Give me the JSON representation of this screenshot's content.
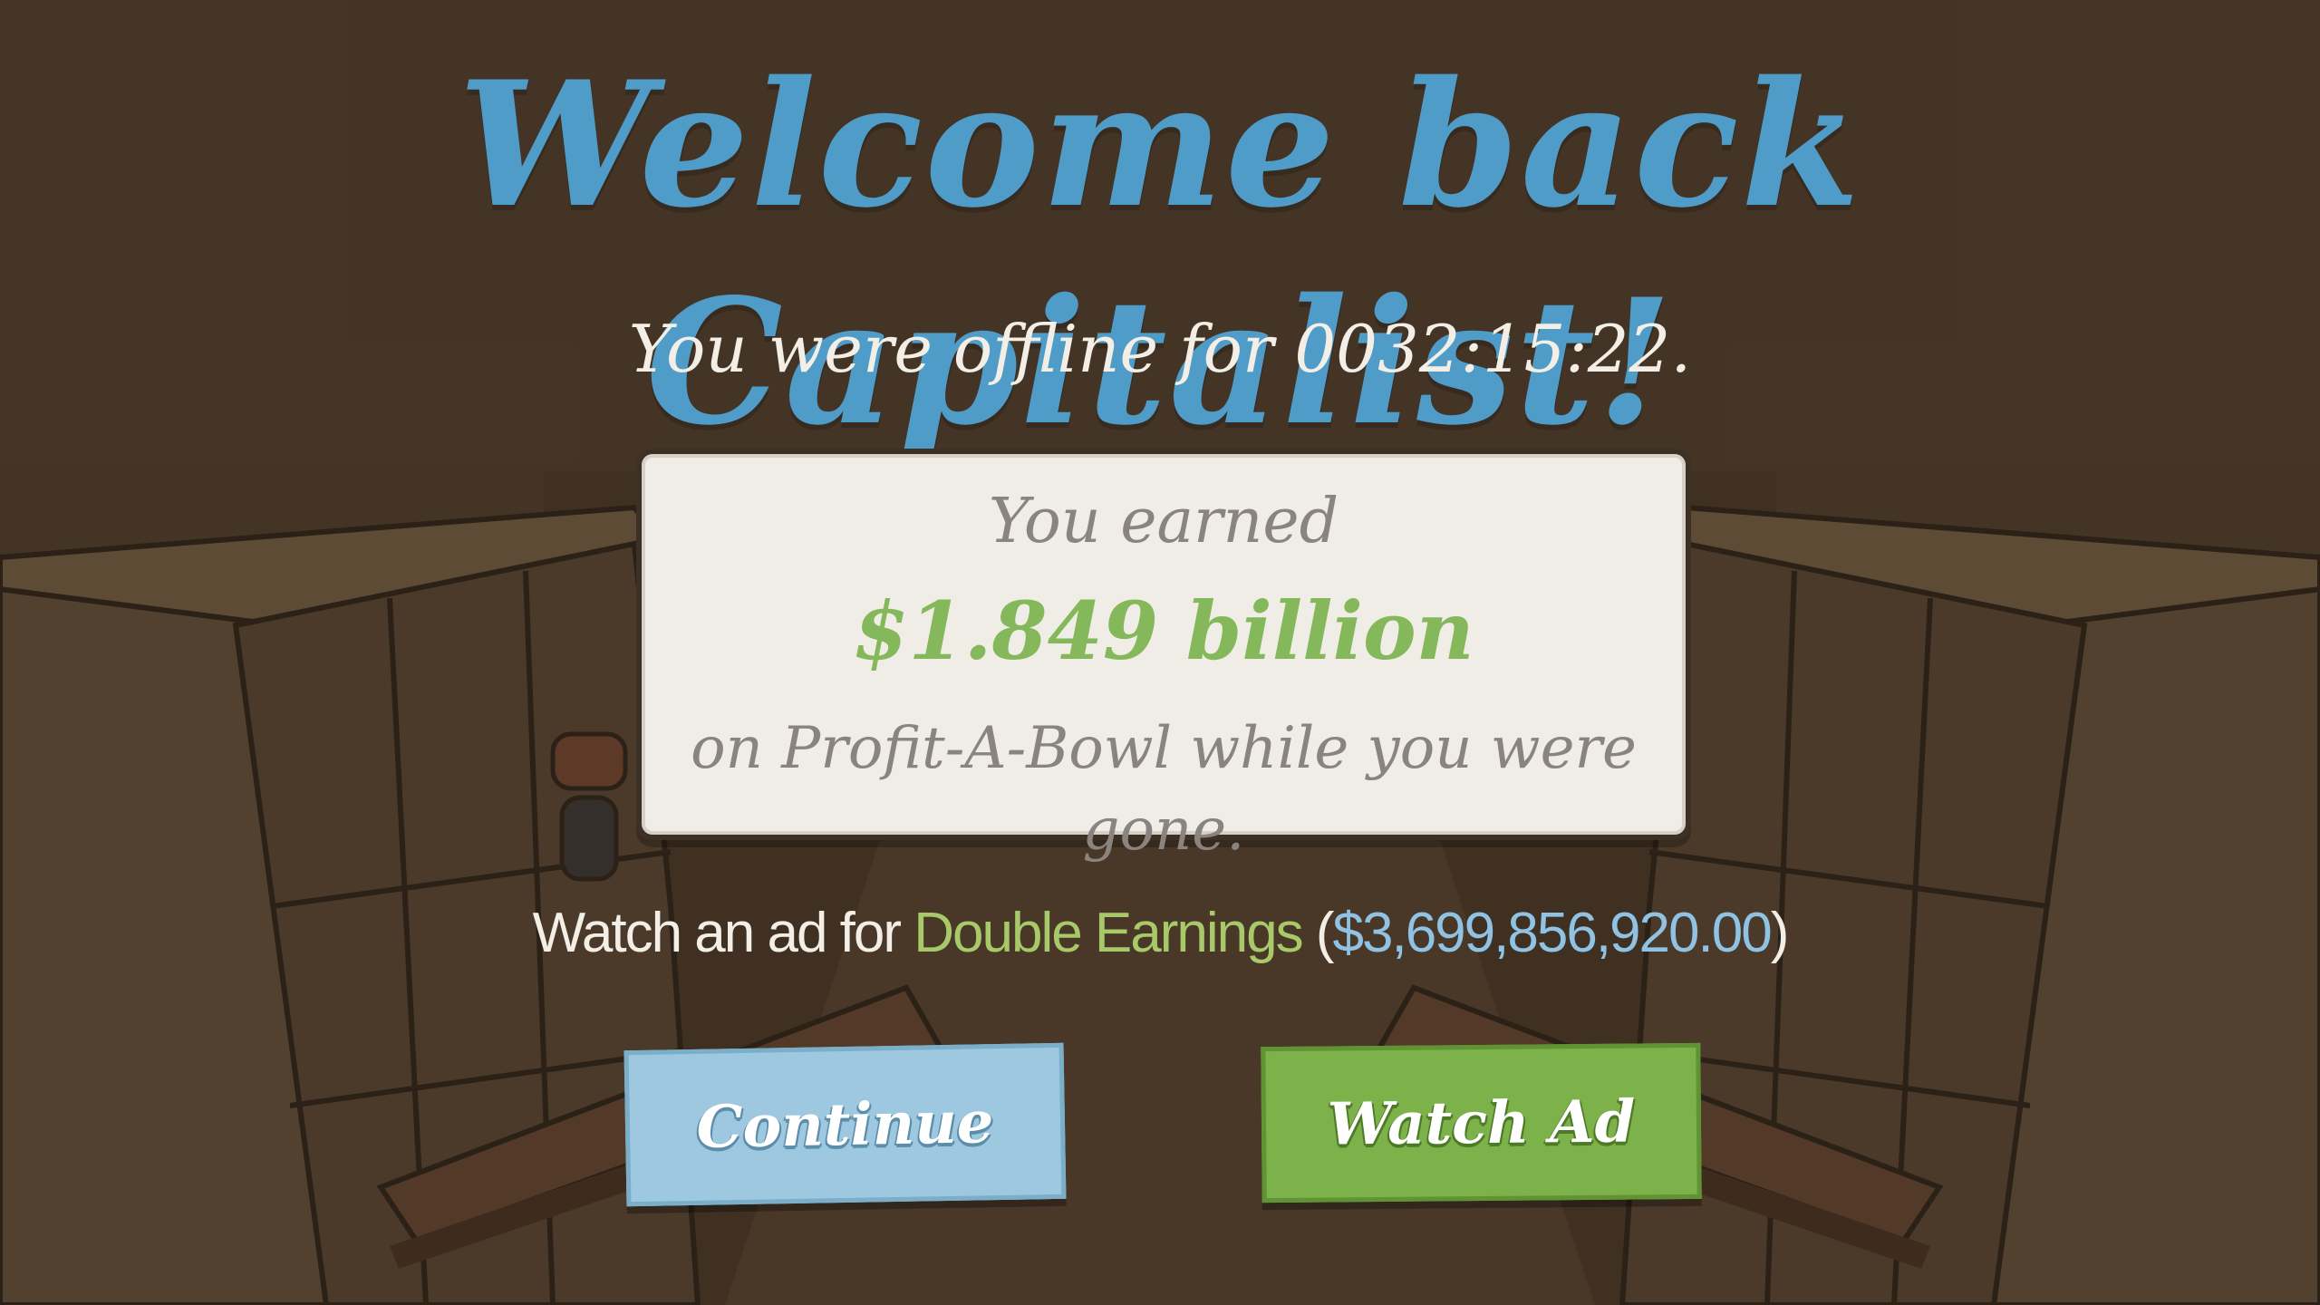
{
  "title": "Welcome back Capitalist!",
  "offline": {
    "text": "You were offline for 0032:15:22."
  },
  "earnings_card": {
    "line1": "You earned",
    "amount": "$1.849 billion",
    "line2": "on Profit-A-Bowl while you were gone."
  },
  "ad_offer": {
    "prefix": "Watch an ad for ",
    "highlight": "Double Earnings",
    "open_paren": " (",
    "amount": "$3,699,856,920.00",
    "close_paren": ")"
  },
  "buttons": {
    "continue_label": "Continue",
    "watch_ad_label": "Watch Ad"
  },
  "colors": {
    "title_blue": "#4f9cc9",
    "amount_green": "#84b85b",
    "double_green": "#a8c96a",
    "amount_blue": "#8fc2e3",
    "continue_bg": "#9ec8df",
    "watch_bg": "#7db149",
    "background": "#54412f"
  }
}
